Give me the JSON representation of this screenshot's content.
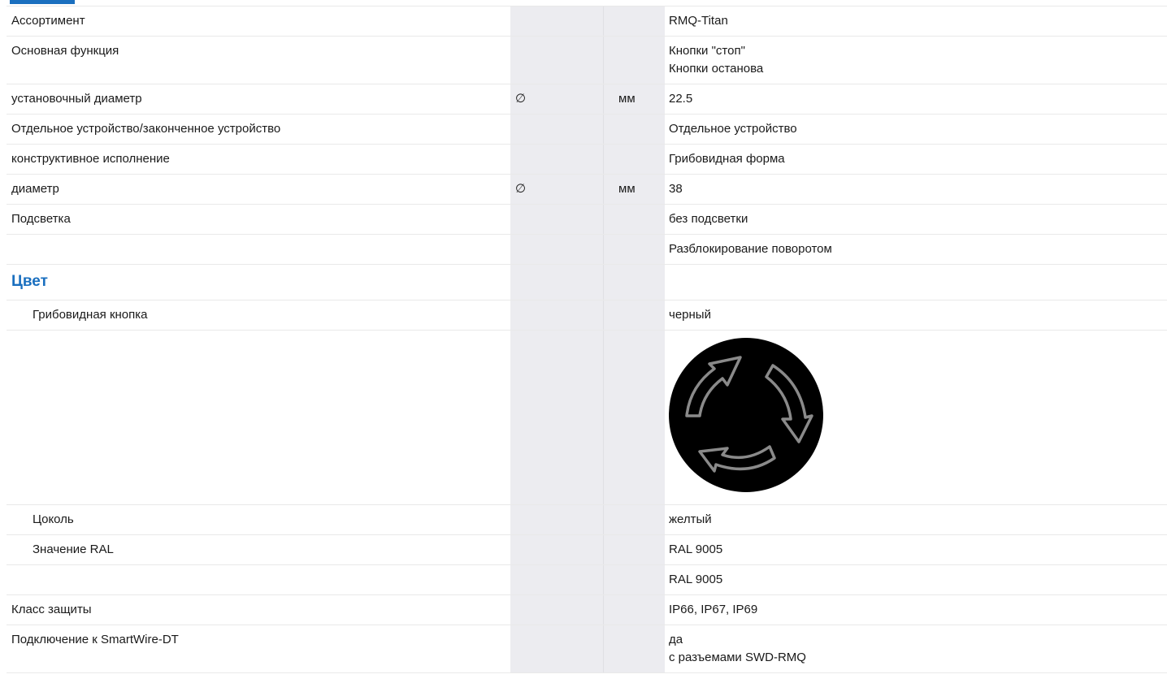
{
  "rows": [
    {
      "name": "Ассортимент",
      "symbol": "",
      "unit": "",
      "values": [
        "RMQ-Titan"
      ]
    },
    {
      "name": "Основная функция",
      "symbol": "",
      "unit": "",
      "values": [
        "Кнопки \"стоп\"",
        "Кнопки останова"
      ]
    },
    {
      "name": "установочный диаметр",
      "symbol": "∅",
      "unit": "мм",
      "values": [
        "22.5"
      ]
    },
    {
      "name": "Отдельное устройство/законченное устройство",
      "symbol": "",
      "unit": "",
      "values": [
        "Отдельное устройство"
      ]
    },
    {
      "name": "конструктивное исполнение",
      "symbol": "",
      "unit": "",
      "values": [
        "Грибовидная форма"
      ]
    },
    {
      "name": "диаметр",
      "symbol": "∅",
      "unit": "мм",
      "values": [
        "38"
      ]
    },
    {
      "name": "Подсветка",
      "symbol": "",
      "unit": "",
      "values": [
        "без подсветки"
      ]
    },
    {
      "name": "",
      "symbol": "",
      "unit": "",
      "values": [
        "Разблокирование поворотом"
      ]
    }
  ],
  "color_section": {
    "title": "Цвет",
    "rows": [
      {
        "name": "Грибовидная кнопка",
        "values": [
          "черный"
        ]
      },
      {
        "name": "Цоколь",
        "values": [
          "желтый"
        ]
      },
      {
        "name": "Значение RAL",
        "values": [
          "RAL 9005"
        ]
      },
      {
        "name": "",
        "values": [
          "RAL 9005"
        ]
      }
    ]
  },
  "bottom_rows": [
    {
      "name": "Класс защиты",
      "values": [
        "IP66, IP67, IP69"
      ]
    },
    {
      "name": "Подключение к SmartWire-DT",
      "values": [
        "да",
        "с разъемами SWD-RMQ"
      ]
    }
  ],
  "colors": {
    "accent": "#1a6fbf",
    "column_shade": "#ececf0",
    "button_fill": "#000000",
    "arrow_stroke": "#8a8a8a"
  },
  "icons": {
    "mushroom_button": "black-mushroom-button-with-rotate-arrows"
  }
}
